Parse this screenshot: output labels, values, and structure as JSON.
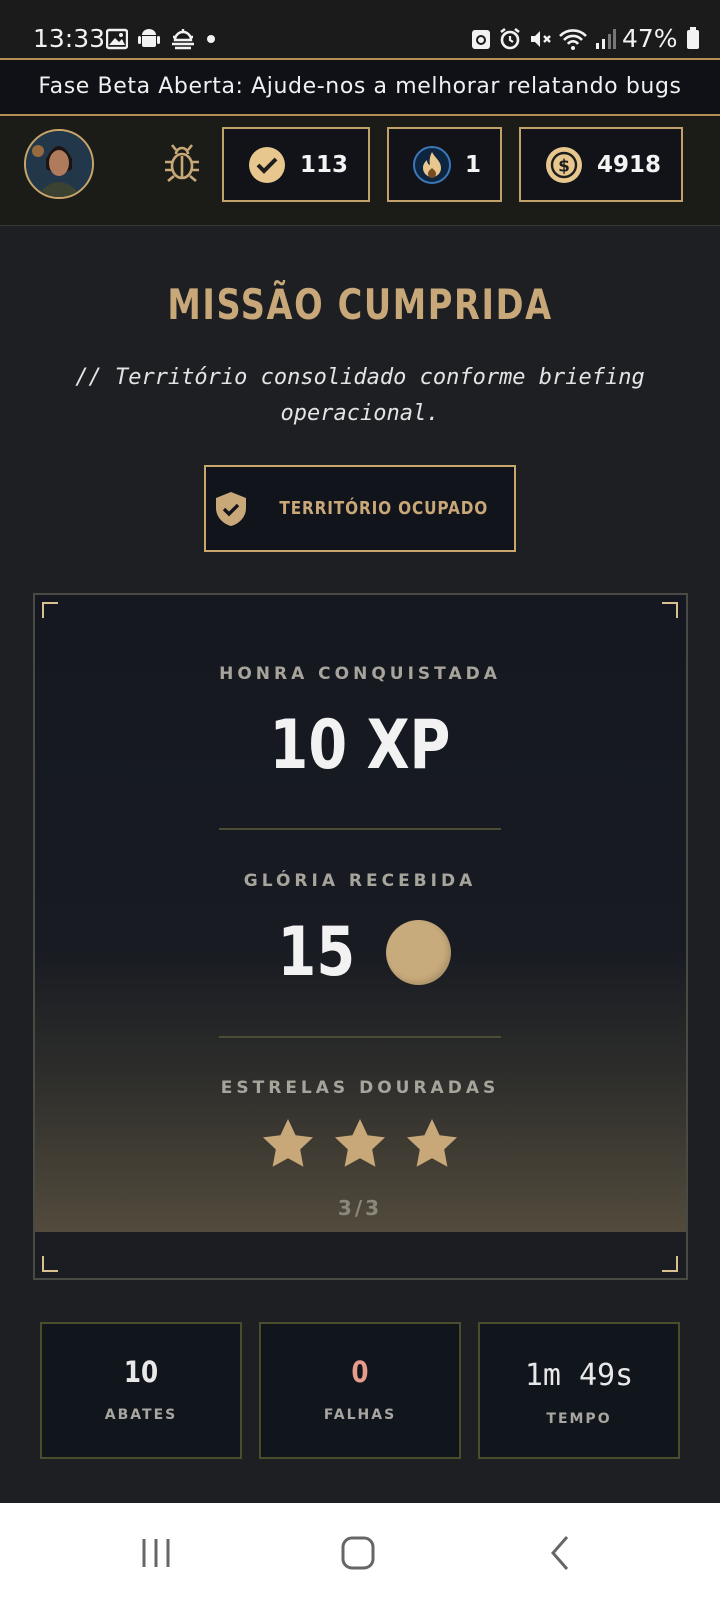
{
  "status_bar": {
    "time": "13:33",
    "battery": "47%",
    "left_icons": [
      "gallery-icon",
      "android-icon",
      "weather-icon",
      "dot-icon"
    ],
    "right_icons": [
      "recycle-icon",
      "alarm-icon",
      "mute-icon",
      "wifi-icon",
      "signal-icon",
      "battery-icon"
    ]
  },
  "banner": {
    "text": "Fase Beta Aberta: Ajude-nos a melhorar relatando bugs"
  },
  "topbar": {
    "avatar_icon": "avatar-portrait",
    "bug_icon": "bug-icon",
    "stats": [
      {
        "name": "missions",
        "icon": "checkmark-icon",
        "value": "113"
      },
      {
        "name": "streak",
        "icon": "flame-icon",
        "value": "1"
      },
      {
        "name": "coins",
        "icon": "dollar-coin-icon",
        "value": "4918"
      }
    ]
  },
  "mission": {
    "title": "MISSÃO CUMPRIDA",
    "subtitle": "// Território consolidado conforme briefing operacional.",
    "status_button": "TERRITÓRIO OCUPADO",
    "status_icon": "shield-check-icon"
  },
  "rewards": {
    "honor_label": "HONRA CONQUISTADA",
    "honor_value": "10 XP",
    "glory_label": "GLÓRIA RECEBIDA",
    "glory_value": "15",
    "stars_label": "ESTRELAS DOURADAS",
    "stars_earned": 3,
    "stars_total": 3,
    "stars_count_text": "3/3"
  },
  "summary": [
    {
      "value": "10",
      "label": "ABATES",
      "color": "#f2f2f2"
    },
    {
      "value": "0",
      "label": "FALHAS",
      "color": "#e79b8b"
    },
    {
      "value": "1m 49s",
      "label": "TEMPO",
      "color": "#f2f2f2"
    }
  ],
  "colors": {
    "accent_gold": "#c8a878",
    "banner_border": "#b48f54",
    "background": "#1d1f23"
  },
  "navbar": {
    "icons": [
      "recents-icon",
      "home-icon",
      "back-icon"
    ]
  }
}
